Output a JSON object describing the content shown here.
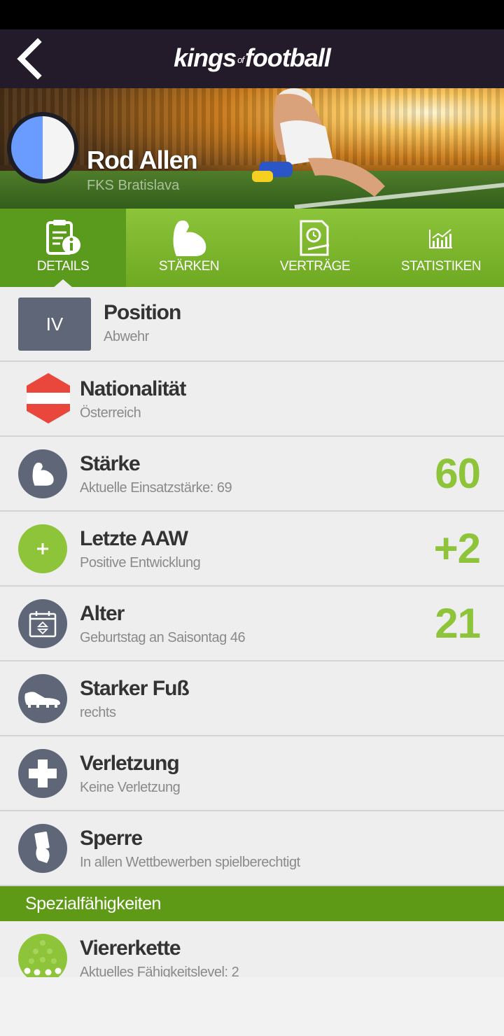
{
  "app": {
    "brand_left": "kings",
    "brand_of": "of",
    "brand_right": "football"
  },
  "colors": {
    "accent": "#8dc43a",
    "tab_bg": "#7cb52a",
    "section_bg": "#5e9a16",
    "icon_bg": "#5e6678",
    "dark": "#231b2a"
  },
  "player": {
    "name": "Rod Allen",
    "club": "FKS Bratislava"
  },
  "tabs": [
    {
      "label": "DETAILS",
      "icon": "clipboard-info-icon",
      "active": true
    },
    {
      "label": "STÄRKEN",
      "icon": "bicep-icon",
      "active": false
    },
    {
      "label": "VERTRÄGE",
      "icon": "contract-icon",
      "active": false
    },
    {
      "label": "STATISTIKEN",
      "icon": "chart-icon",
      "active": false
    }
  ],
  "rows": {
    "position": {
      "badge": "IV",
      "title": "Position",
      "sub": "Abwehr"
    },
    "nationality": {
      "title": "Nationalität",
      "sub": "Österreich"
    },
    "strength": {
      "title": "Stärke",
      "sub": "Aktuelle Einsatzstärke: 69",
      "value": "60"
    },
    "aaw": {
      "title": "Letzte AAW",
      "sub": "Positive Entwicklung",
      "value": "+2"
    },
    "age": {
      "title": "Alter",
      "sub": "Geburtstag an Saisontag 46",
      "value": "21"
    },
    "foot": {
      "title": "Starker Fuß",
      "sub": "rechts"
    },
    "injury": {
      "title": "Verletzung",
      "sub": "Keine Verletzung"
    },
    "ban": {
      "title": "Sperre",
      "sub": "In allen Wettbewerben spielberechtigt"
    }
  },
  "special": {
    "header": "Spezialfähigkeiten",
    "items": [
      {
        "title": "Viererkette",
        "sub": "Aktuelles Fähigkeitslevel: 2"
      }
    ]
  }
}
